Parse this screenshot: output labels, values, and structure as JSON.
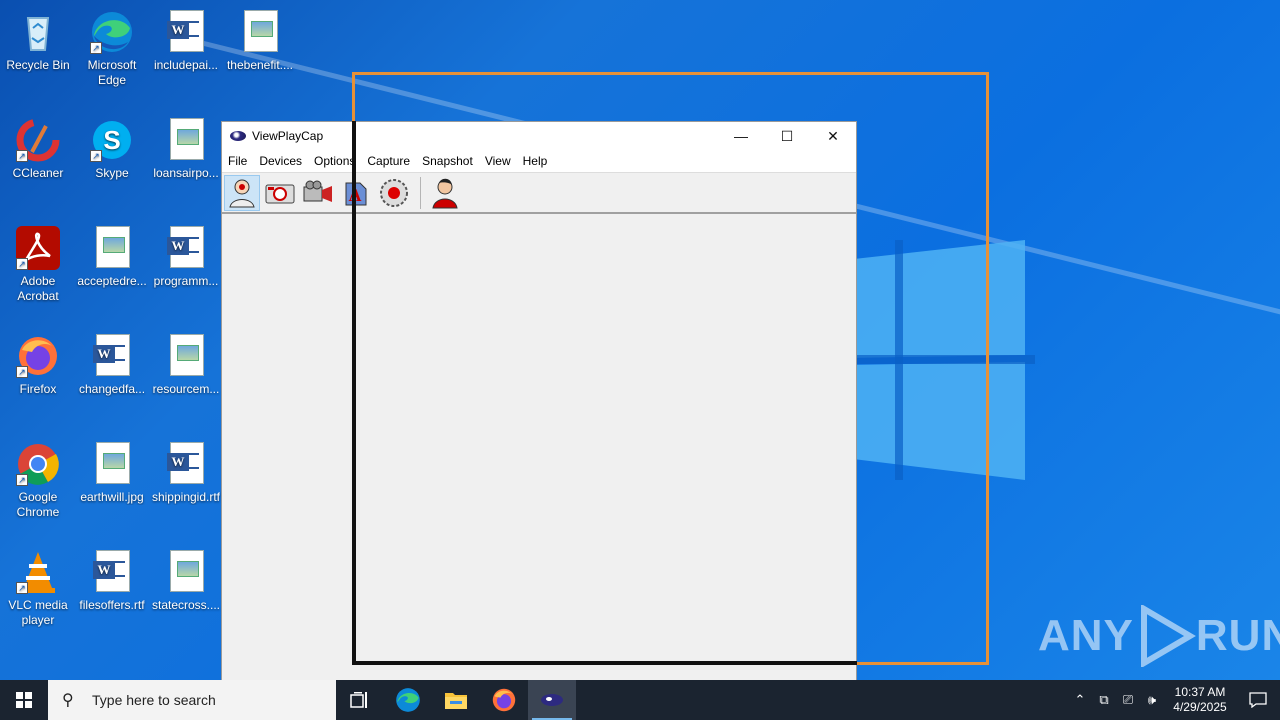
{
  "desktop": {
    "icons": [
      {
        "label": "Recycle Bin",
        "icon": "recycle-bin-icon"
      },
      {
        "label": "Microsoft Edge",
        "icon": "edge-icon"
      },
      {
        "label": "includepai...",
        "icon": "word-doc-icon"
      },
      {
        "label": "thebenefit....",
        "icon": "image-file-icon"
      },
      {
        "label": "CCleaner",
        "icon": "ccleaner-icon"
      },
      {
        "label": "Skype",
        "icon": "skype-icon"
      },
      {
        "label": "loansairpo...",
        "icon": "image-file-icon"
      },
      {
        "label": "Adobe Acrobat",
        "icon": "acrobat-icon"
      },
      {
        "label": "acceptedre...",
        "icon": "image-file-icon"
      },
      {
        "label": "programm...",
        "icon": "word-doc-icon"
      },
      {
        "label": "Firefox",
        "icon": "firefox-icon"
      },
      {
        "label": "changedfa...",
        "icon": "word-doc-icon"
      },
      {
        "label": "resourcem...",
        "icon": "image-file-icon"
      },
      {
        "label": "Google Chrome",
        "icon": "chrome-icon"
      },
      {
        "label": "earthwill.jpg",
        "icon": "image-file-icon"
      },
      {
        "label": "shippingid.rtf",
        "icon": "word-doc-icon"
      },
      {
        "label": "VLC media player",
        "icon": "vlc-icon"
      },
      {
        "label": "filesoffers.rtf",
        "icon": "word-doc-icon"
      },
      {
        "label": "statecross....",
        "icon": "image-file-icon"
      }
    ]
  },
  "window": {
    "title": "ViewPlayCap",
    "controls": {
      "minimize": "—",
      "maximize": "☐",
      "close": "✕"
    },
    "menu": [
      "File",
      "Devices",
      "Options",
      "Capture",
      "Snapshot",
      "View",
      "Help"
    ],
    "toolbar": [
      "webcam-preview-icon",
      "snapshot-camera-icon",
      "video-capture-icon",
      "audio-settings-icon",
      "record-icon",
      "user-icon"
    ]
  },
  "watermark": {
    "text_left": "ANY",
    "text_right": "RUN"
  },
  "taskbar": {
    "search_placeholder": "Type here to search",
    "apps": [
      "task-view-icon",
      "edge-icon",
      "file-explorer-icon",
      "firefox-icon",
      "viewplaycap-icon"
    ],
    "active_app": "viewplaycap-icon",
    "tray": {
      "time": "10:37 AM",
      "date": "4/29/2025"
    }
  },
  "colors": {
    "overlay_orange": "#e69138",
    "taskbar": "#1b2430",
    "desktop_blue": "#0b6fe0"
  }
}
